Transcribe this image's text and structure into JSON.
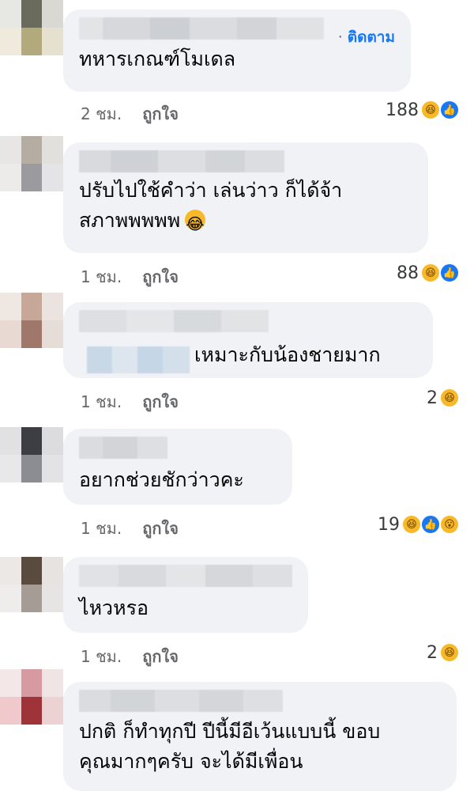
{
  "comments": [
    {
      "text": "ทหารเกณฑ์โมเดล",
      "follow_label": "ติดตาม",
      "time": "2 ชม.",
      "like_label": "ถูกใจ",
      "reaction_count": "188",
      "reactions": [
        "haha-icon",
        "like-icon"
      ]
    },
    {
      "text": "ปรับไปใช้คำว่า เล่นว่าว ก็ได้จ้า\nสภาพพพพพ",
      "inline_emoji": "😂",
      "time": "1 ชม.",
      "like_label": "ถูกใจ",
      "reaction_count": "88",
      "reactions": [
        "haha-icon",
        "like-icon"
      ]
    },
    {
      "text": "เหมาะกับน้องชายมาก",
      "time": "1 ชม.",
      "like_label": "ถูกใจ",
      "reaction_count": "2",
      "reactions": [
        "haha-icon"
      ]
    },
    {
      "text": "อยากช่วยชักว่าวคะ",
      "time": "1 ชม.",
      "like_label": "ถูกใจ",
      "reaction_count": "19",
      "reactions": [
        "haha-icon",
        "like-icon",
        "wow-icon"
      ]
    },
    {
      "text": "ไหวหรอ",
      "time": "1 ชม.",
      "like_label": "ถูกใจ",
      "reaction_count": "2",
      "reactions": [
        "haha-icon"
      ]
    },
    {
      "text": "ปกติ ก็ทำทุกปี ปีนี้มีอีเว้นแบบนี้ ขอบ\nคุณมากๆครับ จะได้มีเพื่อน"
    }
  ],
  "colors": {
    "bubble": "#f0f2f5",
    "follow": "#1877f2",
    "meta": "#65676b",
    "haha": "#f7b928",
    "like": "#1877f2"
  }
}
